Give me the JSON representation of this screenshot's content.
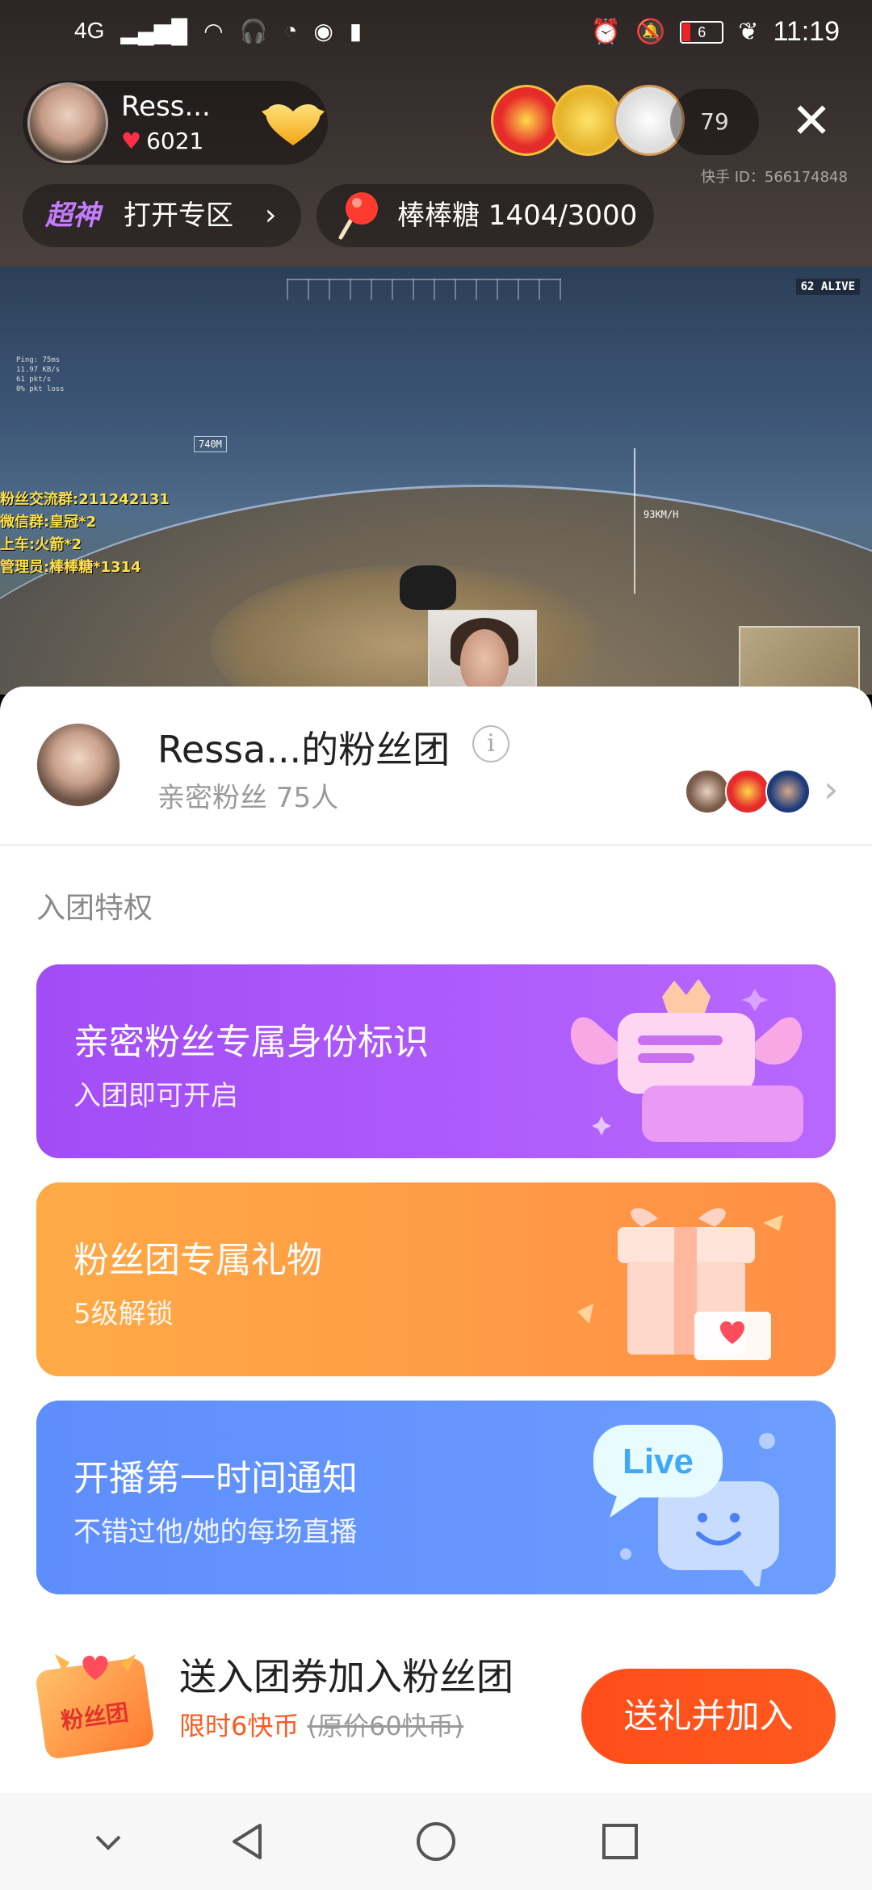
{
  "status_bar": {
    "network": "4G",
    "battery": "6",
    "time": "11:19"
  },
  "streamer": {
    "name": "Ress...",
    "likes": "6021"
  },
  "viewers": {
    "count": "79"
  },
  "kuaishou_id": "快手 ID：566174848",
  "zone": {
    "badge": "超神",
    "label": "打开专区",
    "arrow": "›"
  },
  "candy": {
    "label": "棒棒糖 1404/3000"
  },
  "stream_overlay": {
    "alive": "62 ALIVE",
    "altitude": "740M",
    "speed": "93KM/H",
    "stats": [
      "Ping: 75ms",
      "11.97 KB/s",
      "61 pkt/s",
      "0% pkt loss"
    ],
    "info_lines": [
      "粉丝交流群:211242131",
      "微信群:皇冠*2",
      "上车:火箭*2",
      "管理员:棒棒糖*1314"
    ]
  },
  "sheet": {
    "title": "Ressa...的粉丝团",
    "info_icon": "i",
    "subtitle": "亲密粉丝 75人",
    "more_arrow": "›",
    "perk_heading": "入团特权",
    "perks": [
      {
        "title": "亲密粉丝专属身份标识",
        "subtitle": "入团即可开启",
        "color": "#a24cf6"
      },
      {
        "title": "粉丝团专属礼物",
        "subtitle": "5级解锁",
        "color": "#ff9a46"
      },
      {
        "title": "开播第一时间通知",
        "subtitle": "不错过他/她的每场直播",
        "color": "#6594fd",
        "art_text": "Live"
      }
    ]
  },
  "join": {
    "badge_text": "粉丝团",
    "title": "送入团券加入粉丝团",
    "price": "限时6快币",
    "original_price": "(原价60快币)",
    "button": "送礼并加入"
  },
  "colors": {
    "accent": "#ff5a1f",
    "purple": "#a24cf6",
    "orange": "#ff9a46",
    "blue": "#6594fd"
  }
}
